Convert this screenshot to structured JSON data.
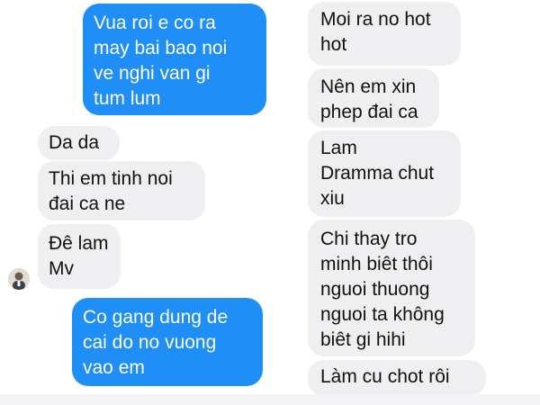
{
  "left_column": {
    "messages": [
      {
        "type": "sent",
        "text": "Vua roi e co ra\nmay bai bao noi\nve nghi van gi\ntum lum"
      },
      {
        "type": "received",
        "text": "Da da"
      },
      {
        "type": "received",
        "text": "Thi em tinh noi\nđai ca ne"
      },
      {
        "type": "received",
        "text": "Đê lam\nMv"
      },
      {
        "type": "sent",
        "text": "Co gang dung de\ncai do no vuong\nvao em"
      }
    ],
    "avatar_icon": "person-avatar-icon"
  },
  "right_column": {
    "messages": [
      {
        "type": "received",
        "text": "Moi ra no hot\nhot"
      },
      {
        "type": "received",
        "text": "Nên em xin\nphep đai ca"
      },
      {
        "type": "received",
        "text": "Lam\nDramma chut\nxiu"
      },
      {
        "type": "received",
        "text": "Chi thay tro\nminh biêt thôi\nnguoi thuong\nnguoi ta không\nbiêt gi hihi"
      },
      {
        "type": "received",
        "text": "Làm cu chot rôi"
      }
    ]
  },
  "colors": {
    "sent_bubble": "#1f8ef6",
    "received_bubble": "#efeff2",
    "background": "#ffffff"
  }
}
